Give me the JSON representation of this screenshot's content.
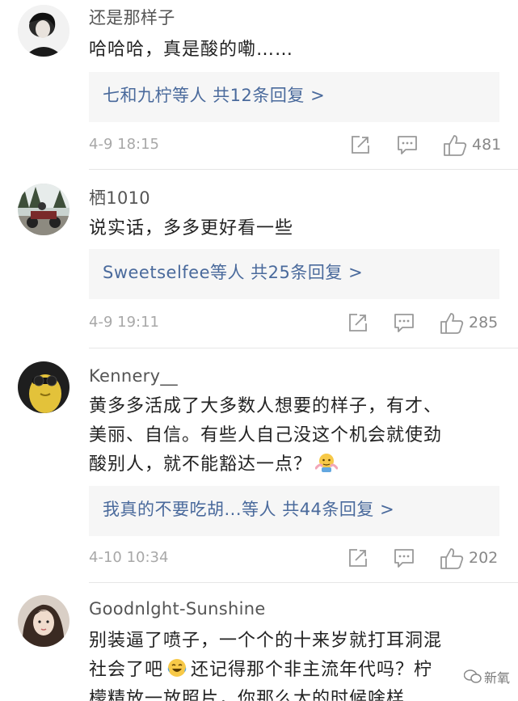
{
  "comments": [
    {
      "username": "还是那样子",
      "text": "哈哈哈，真是酸的嘞……",
      "reply_summary": "七和九柠等人 共12条回复 >",
      "time": "4-9 18:15",
      "likes": "481"
    },
    {
      "username": "栖1010",
      "text": "说实话，多多更好看一些",
      "reply_summary": "Sweetselfee等人 共25条回复 >",
      "time": "4-9 19:11",
      "likes": "285"
    },
    {
      "username": "Kennery__",
      "text_lines": [
        "黄多多活成了大多数人想要的样子，有才、",
        "美丽、自信。有些人自己没这个机会就使劲",
        "酸别人，就不能豁达一点？"
      ],
      "reply_summary": "我真的不要吃胡...等人 共44条回复 >",
      "time": "4-10 10:34",
      "likes": "202"
    },
    {
      "username": "Goodnlght-Sunshine",
      "text_lines": [
        "别装逼了喷子，一个个的十来岁就打耳洞混",
        "社会了吧",
        "还记得那个非主流年代吗？柠",
        "檬精放一放照片，你那么大的时候啥样"
      ]
    }
  ],
  "watermark": "新氧",
  "icons": {
    "share": "share-icon",
    "comment": "comment-icon",
    "like": "thumbs-up-icon",
    "emoji_shrug": "shrug-emoji-icon",
    "emoji_laugh": "laughing-tears-emoji-icon",
    "watermark_logo": "wechat-logo-icon"
  }
}
